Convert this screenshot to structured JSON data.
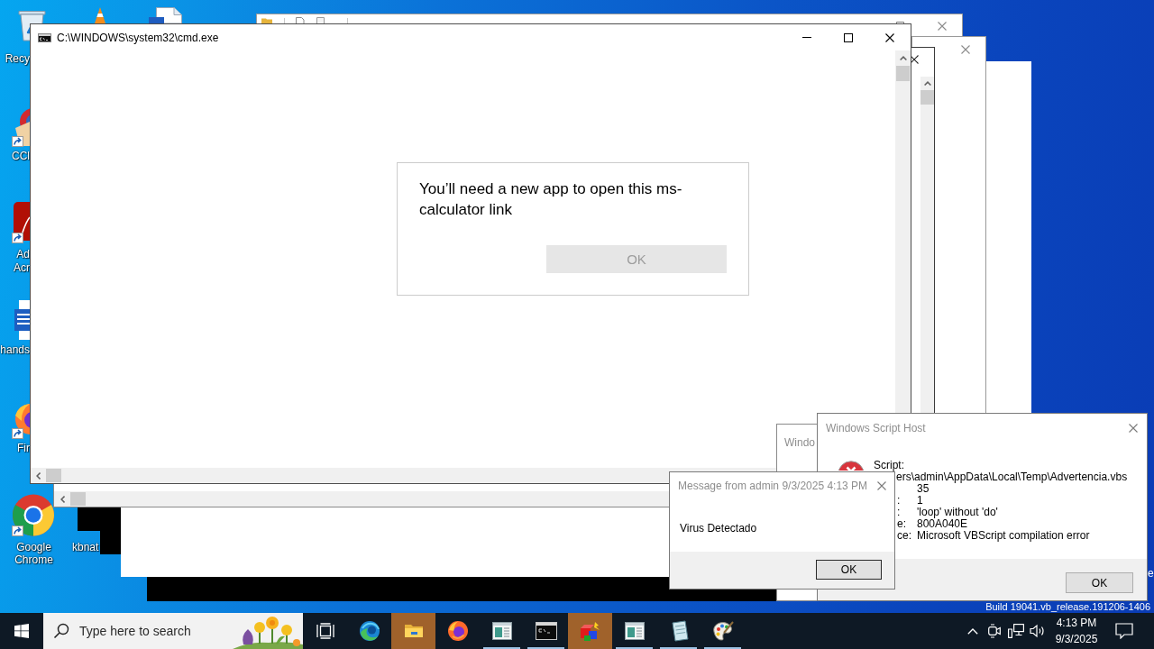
{
  "desktop": {
    "icons": [
      {
        "kind": "recycle-bin",
        "shortcut": false,
        "label_lines": [
          "Recy"
        ]
      },
      {
        "kind": "cone"
      },
      {
        "kind": "document"
      },
      {
        "kind": "cleaner",
        "shortcut": true,
        "label_lines": [
          "CCl"
        ]
      },
      {
        "kind": "pdf",
        "shortcut": true,
        "label_lines": [
          "Ad",
          "Acr"
        ]
      },
      {
        "kind": "word",
        "shortcut": false,
        "label_lines": [
          "hands"
        ]
      },
      {
        "kind": "firefox",
        "shortcut": true,
        "label_lines": [
          "Fir"
        ]
      },
      {
        "kind": "chrome",
        "shortcut": true,
        "label_lines": [
          "Google",
          "Chrome"
        ]
      },
      {
        "label_lines": [
          "kbnat"
        ]
      }
    ],
    "corner_lines": [
      "e",
      "Build 19041.vb_release.191206-1406"
    ]
  },
  "console_window": {
    "title": "C:\\WINDOWS\\system32\\cmd.exe"
  },
  "app_prompt": {
    "message": "You’ll need a new app to open this ms-calculator link",
    "button": {
      "label": "OK",
      "disabled": true
    }
  },
  "partial_window": {
    "title": "Windo"
  },
  "script_host": {
    "title": "Windows Script Host",
    "lines": [
      {
        "kind": "label",
        "label": "Script:"
      },
      {
        "kind": "wide",
        "value": "ers\\admin\\AppData\\Local\\Temp\\Advertencia.vbs"
      },
      {
        "kind": "pair",
        "value": "35"
      },
      {
        "kind": "pair",
        "label": ":",
        "value": "1"
      },
      {
        "kind": "pair",
        "label": ":",
        "value": "'loop' without 'do'"
      },
      {
        "kind": "pair",
        "label": "e:",
        "value": "800A040E"
      },
      {
        "kind": "pair",
        "label": "ce:",
        "value": "Microsoft VBScript compilation error"
      }
    ],
    "button": "OK"
  },
  "message_box": {
    "title": "Message from admin 9/3/2025 4:13 PM",
    "message": "Virus Detectado",
    "button": "OK"
  },
  "taskbar": {
    "search": {
      "placeholder": "Type here to search"
    },
    "apps": [
      {
        "kind": "edge",
        "flashing": false,
        "running": false
      },
      {
        "kind": "folder",
        "flashing": true,
        "running": false
      },
      {
        "kind": "firefox",
        "flashing": false,
        "running": false
      },
      {
        "kind": "window",
        "flashing": false,
        "running": true
      },
      {
        "kind": "terminal",
        "flashing": false,
        "running": true
      },
      {
        "kind": "cubes",
        "flashing": true,
        "running": false
      },
      {
        "kind": "window",
        "flashing": false,
        "running": true
      },
      {
        "kind": "notepad",
        "flashing": false,
        "running": true
      },
      {
        "kind": "palette",
        "flashing": false,
        "running": true
      }
    ],
    "clock": {
      "time": "4:13 PM",
      "date": "9/3/2025"
    }
  }
}
